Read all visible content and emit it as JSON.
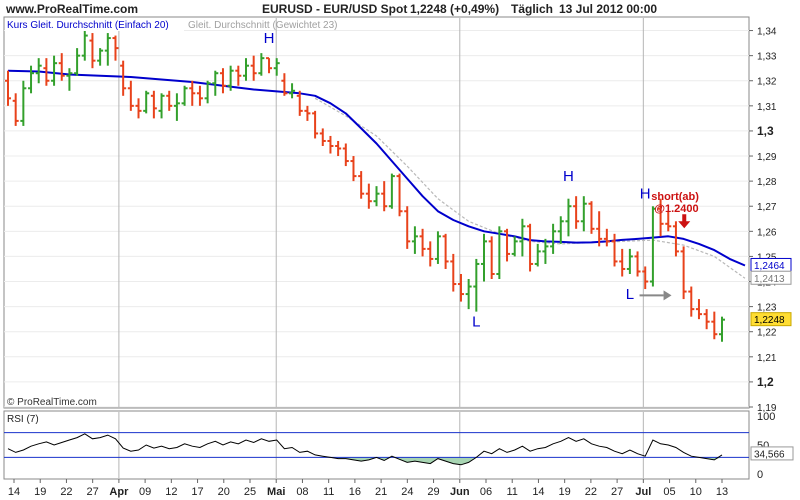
{
  "header": {
    "site": "www.ProRealTime.com",
    "title": "EURUSD - EUR/USD Spot",
    "quote": "1,2248 (+0,49%)",
    "period": "Täglich",
    "date": "13 Jul 2012 00:00"
  },
  "footer": {
    "copyright": "© ProRealTime.com"
  },
  "colors": {
    "up": "#33a02c",
    "down": "#e8421b",
    "sma": "#0000cc",
    "wma": "#b8b8b8",
    "rsi_line": "#000000",
    "rsi_fill": "#a8d5b3",
    "rsi_level": "#1a33cc",
    "annotation_blue": "#0000cc",
    "annotation_red": "#cc1111",
    "price_badge": "#ffdd33"
  },
  "chart_data": [
    {
      "type": "ohlc",
      "legend": [
        {
          "label": "Kurs Gleit. Durchschnitt (Einfach 20)",
          "color": "#0000cc"
        },
        {
          "label": "Gleit. Durchschnitt (Gewichtet 23)",
          "color": "#b8b8b8"
        }
      ],
      "ylim": [
        1.19,
        1.345
      ],
      "y_ticks": [
        "1,34",
        "1,33",
        "1,32",
        "1,31",
        "1,3",
        "1,29",
        "1,28",
        "1,27",
        "1,26",
        "1,25",
        "1,24",
        "1,23",
        "1,22",
        "1,21",
        "1,2",
        "1,19"
      ],
      "x_labels": [
        "14",
        "19",
        "22",
        "27",
        "Apr",
        "09",
        "12",
        "17",
        "20",
        "25",
        "Mai",
        "08",
        "11",
        "16",
        "21",
        "24",
        "29",
        "Jun",
        "06",
        "11",
        "14",
        "19",
        "22",
        "27",
        "Jul",
        "05",
        "10",
        "13"
      ],
      "bars": [
        {
          "o": 1.32,
          "h": 1.324,
          "l": 1.31,
          "c": 1.313
        },
        {
          "o": 1.312,
          "h": 1.315,
          "l": 1.302,
          "c": 1.304
        },
        {
          "o": 1.304,
          "h": 1.32,
          "l": 1.302,
          "c": 1.317
        },
        {
          "o": 1.317,
          "h": 1.326,
          "l": 1.315,
          "c": 1.323
        },
        {
          "o": 1.323,
          "h": 1.329,
          "l": 1.319,
          "c": 1.326
        },
        {
          "o": 1.325,
          "h": 1.329,
          "l": 1.318,
          "c": 1.32
        },
        {
          "o": 1.32,
          "h": 1.33,
          "l": 1.318,
          "c": 1.327
        },
        {
          "o": 1.327,
          "h": 1.331,
          "l": 1.32,
          "c": 1.322
        },
        {
          "o": 1.322,
          "h": 1.325,
          "l": 1.316,
          "c": 1.323
        },
        {
          "o": 1.323,
          "h": 1.333,
          "l": 1.322,
          "c": 1.33
        },
        {
          "o": 1.33,
          "h": 1.34,
          "l": 1.328,
          "c": 1.338
        },
        {
          "o": 1.336,
          "h": 1.339,
          "l": 1.325,
          "c": 1.328
        },
        {
          "o": 1.328,
          "h": 1.333,
          "l": 1.326,
          "c": 1.332
        },
        {
          "o": 1.332,
          "h": 1.339,
          "l": 1.326,
          "c": 1.337
        },
        {
          "o": 1.337,
          "h": 1.338,
          "l": 1.328,
          "c": 1.333
        },
        {
          "o": 1.326,
          "h": 1.328,
          "l": 1.314,
          "c": 1.317
        },
        {
          "o": 1.317,
          "h": 1.32,
          "l": 1.308,
          "c": 1.31
        },
        {
          "o": 1.31,
          "h": 1.313,
          "l": 1.305,
          "c": 1.308
        },
        {
          "o": 1.308,
          "h": 1.316,
          "l": 1.307,
          "c": 1.315
        },
        {
          "o": 1.314,
          "h": 1.316,
          "l": 1.305,
          "c": 1.309
        },
        {
          "o": 1.308,
          "h": 1.315,
          "l": 1.305,
          "c": 1.314
        },
        {
          "o": 1.314,
          "h": 1.316,
          "l": 1.308,
          "c": 1.31
        },
        {
          "o": 1.31,
          "h": 1.315,
          "l": 1.304,
          "c": 1.311
        },
        {
          "o": 1.311,
          "h": 1.318,
          "l": 1.31,
          "c": 1.317
        },
        {
          "o": 1.317,
          "h": 1.32,
          "l": 1.31,
          "c": 1.315
        },
        {
          "o": 1.315,
          "h": 1.318,
          "l": 1.31,
          "c": 1.313
        },
        {
          "o": 1.313,
          "h": 1.32,
          "l": 1.311,
          "c": 1.319
        },
        {
          "o": 1.319,
          "h": 1.324,
          "l": 1.314,
          "c": 1.323
        },
        {
          "o": 1.323,
          "h": 1.325,
          "l": 1.315,
          "c": 1.318
        },
        {
          "o": 1.318,
          "h": 1.326,
          "l": 1.316,
          "c": 1.324
        },
        {
          "o": 1.324,
          "h": 1.326,
          "l": 1.318,
          "c": 1.322
        },
        {
          "o": 1.322,
          "h": 1.329,
          "l": 1.32,
          "c": 1.326
        },
        {
          "o": 1.326,
          "h": 1.33,
          "l": 1.32,
          "c": 1.323
        },
        {
          "o": 1.323,
          "h": 1.331,
          "l": 1.322,
          "c": 1.329
        },
        {
          "o": 1.329,
          "h": 1.329,
          "l": 1.323,
          "c": 1.325
        },
        {
          "o": 1.325,
          "h": 1.329,
          "l": 1.322,
          "c": 1.327
        },
        {
          "o": 1.32,
          "h": 1.323,
          "l": 1.314,
          "c": 1.315
        },
        {
          "o": 1.315,
          "h": 1.319,
          "l": 1.313,
          "c": 1.316
        },
        {
          "o": 1.314,
          "h": 1.316,
          "l": 1.306,
          "c": 1.308
        },
        {
          "o": 1.308,
          "h": 1.31,
          "l": 1.304,
          "c": 1.307
        },
        {
          "o": 1.307,
          "h": 1.308,
          "l": 1.297,
          "c": 1.299
        },
        {
          "o": 1.299,
          "h": 1.301,
          "l": 1.294,
          "c": 1.296
        },
        {
          "o": 1.296,
          "h": 1.298,
          "l": 1.291,
          "c": 1.294
        },
        {
          "o": 1.294,
          "h": 1.296,
          "l": 1.29,
          "c": 1.293
        },
        {
          "o": 1.293,
          "h": 1.295,
          "l": 1.286,
          "c": 1.288
        },
        {
          "o": 1.288,
          "h": 1.29,
          "l": 1.28,
          "c": 1.282
        },
        {
          "o": 1.282,
          "h": 1.284,
          "l": 1.273,
          "c": 1.275
        },
        {
          "o": 1.275,
          "h": 1.279,
          "l": 1.269,
          "c": 1.272
        },
        {
          "o": 1.272,
          "h": 1.278,
          "l": 1.27,
          "c": 1.275
        },
        {
          "o": 1.275,
          "h": 1.28,
          "l": 1.268,
          "c": 1.27
        },
        {
          "o": 1.27,
          "h": 1.283,
          "l": 1.269,
          "c": 1.282
        },
        {
          "o": 1.282,
          "h": 1.283,
          "l": 1.266,
          "c": 1.268
        },
        {
          "o": 1.268,
          "h": 1.27,
          "l": 1.253,
          "c": 1.256
        },
        {
          "o": 1.256,
          "h": 1.262,
          "l": 1.251,
          "c": 1.258
        },
        {
          "o": 1.258,
          "h": 1.261,
          "l": 1.25,
          "c": 1.253
        },
        {
          "o": 1.253,
          "h": 1.256,
          "l": 1.246,
          "c": 1.249
        },
        {
          "o": 1.249,
          "h": 1.26,
          "l": 1.247,
          "c": 1.258
        },
        {
          "o": 1.258,
          "h": 1.259,
          "l": 1.245,
          "c": 1.248
        },
        {
          "o": 1.248,
          "h": 1.251,
          "l": 1.236,
          "c": 1.239
        },
        {
          "o": 1.239,
          "h": 1.243,
          "l": 1.232,
          "c": 1.235
        },
        {
          "o": 1.235,
          "h": 1.241,
          "l": 1.229,
          "c": 1.238
        },
        {
          "o": 1.238,
          "h": 1.249,
          "l": 1.228,
          "c": 1.247
        },
        {
          "o": 1.247,
          "h": 1.259,
          "l": 1.24,
          "c": 1.256
        },
        {
          "o": 1.256,
          "h": 1.258,
          "l": 1.241,
          "c": 1.243
        },
        {
          "o": 1.243,
          "h": 1.262,
          "l": 1.241,
          "c": 1.26
        },
        {
          "o": 1.26,
          "h": 1.261,
          "l": 1.248,
          "c": 1.251
        },
        {
          "o": 1.251,
          "h": 1.258,
          "l": 1.25,
          "c": 1.256
        },
        {
          "o": 1.256,
          "h": 1.265,
          "l": 1.25,
          "c": 1.262
        },
        {
          "o": 1.262,
          "h": 1.263,
          "l": 1.244,
          "c": 1.247
        },
        {
          "o": 1.247,
          "h": 1.255,
          "l": 1.246,
          "c": 1.252
        },
        {
          "o": 1.252,
          "h": 1.257,
          "l": 1.247,
          "c": 1.254
        },
        {
          "o": 1.254,
          "h": 1.263,
          "l": 1.251,
          "c": 1.26
        },
        {
          "o": 1.26,
          "h": 1.266,
          "l": 1.255,
          "c": 1.264
        },
        {
          "o": 1.264,
          "h": 1.273,
          "l": 1.258,
          "c": 1.27
        },
        {
          "o": 1.27,
          "h": 1.274,
          "l": 1.261,
          "c": 1.264
        },
        {
          "o": 1.264,
          "h": 1.274,
          "l": 1.26,
          "c": 1.271
        },
        {
          "o": 1.271,
          "h": 1.272,
          "l": 1.259,
          "c": 1.261
        },
        {
          "o": 1.261,
          "h": 1.268,
          "l": 1.254,
          "c": 1.257
        },
        {
          "o": 1.257,
          "h": 1.261,
          "l": 1.254,
          "c": 1.256
        },
        {
          "o": 1.256,
          "h": 1.259,
          "l": 1.246,
          "c": 1.248
        },
        {
          "o": 1.248,
          "h": 1.253,
          "l": 1.242,
          "c": 1.245
        },
        {
          "o": 1.245,
          "h": 1.253,
          "l": 1.243,
          "c": 1.25
        },
        {
          "o": 1.25,
          "h": 1.252,
          "l": 1.242,
          "c": 1.244
        },
        {
          "o": 1.244,
          "h": 1.246,
          "l": 1.237,
          "c": 1.24
        },
        {
          "o": 1.24,
          "h": 1.27,
          "l": 1.238,
          "c": 1.269
        },
        {
          "o": 1.269,
          "h": 1.273,
          "l": 1.258,
          "c": 1.263
        },
        {
          "o": 1.263,
          "h": 1.268,
          "l": 1.26,
          "c": 1.262
        },
        {
          "o": 1.262,
          "h": 1.264,
          "l": 1.25,
          "c": 1.252
        },
        {
          "o": 1.252,
          "h": 1.254,
          "l": 1.233,
          "c": 1.236
        },
        {
          "o": 1.236,
          "h": 1.238,
          "l": 1.226,
          "c": 1.229
        },
        {
          "o": 1.229,
          "h": 1.233,
          "l": 1.225,
          "c": 1.227
        },
        {
          "o": 1.227,
          "h": 1.229,
          "l": 1.221,
          "c": 1.224
        },
        {
          "o": 1.224,
          "h": 1.228,
          "l": 1.217,
          "c": 1.219
        },
        {
          "o": 1.219,
          "h": 1.226,
          "l": 1.216,
          "c": 1.2248
        }
      ],
      "sma_20": [
        [
          0,
          1.324
        ],
        [
          4,
          1.3237
        ],
        [
          8,
          1.3225
        ],
        [
          12,
          1.322
        ],
        [
          16,
          1.3215
        ],
        [
          20,
          1.3205
        ],
        [
          24,
          1.3195
        ],
        [
          28,
          1.318
        ],
        [
          32,
          1.3165
        ],
        [
          36,
          1.3155
        ],
        [
          38,
          1.315
        ],
        [
          40,
          1.314
        ],
        [
          42,
          1.311
        ],
        [
          44,
          1.307
        ],
        [
          46,
          1.301
        ],
        [
          48,
          1.295
        ],
        [
          50,
          1.288
        ],
        [
          52,
          1.281
        ],
        [
          54,
          1.274
        ],
        [
          56,
          1.268
        ],
        [
          58,
          1.2645
        ],
        [
          60,
          1.262
        ],
        [
          62,
          1.26
        ],
        [
          64,
          1.259
        ],
        [
          66,
          1.258
        ],
        [
          68,
          1.2565
        ],
        [
          70,
          1.256
        ],
        [
          72,
          1.2558
        ],
        [
          74,
          1.2555
        ],
        [
          76,
          1.2556
        ],
        [
          78,
          1.256
        ],
        [
          80,
          1.2566
        ],
        [
          82,
          1.257
        ],
        [
          84,
          1.2575
        ],
        [
          86,
          1.258
        ],
        [
          88,
          1.257
        ],
        [
          90,
          1.255
        ],
        [
          92,
          1.2525
        ],
        [
          94,
          1.249
        ],
        [
          96,
          1.2464
        ]
      ],
      "wma_23": [
        [
          40,
          1.313
        ],
        [
          44,
          1.306
        ],
        [
          48,
          1.298
        ],
        [
          52,
          1.286
        ],
        [
          56,
          1.273
        ],
        [
          60,
          1.264
        ],
        [
          64,
          1.259
        ],
        [
          68,
          1.256
        ],
        [
          72,
          1.255
        ],
        [
          76,
          1.2555
        ],
        [
          80,
          1.256
        ],
        [
          84,
          1.2565
        ],
        [
          88,
          1.2545
        ],
        [
          92,
          1.25
        ],
        [
          96,
          1.2413
        ]
      ],
      "annotations": [
        {
          "label": "H",
          "bar": 34,
          "price": 1.335,
          "color": "#0000cc"
        },
        {
          "label": "L",
          "bar": 61,
          "price": 1.222,
          "color": "#0000cc"
        },
        {
          "label": "H",
          "bar": 73,
          "price": 1.28,
          "color": "#0000cc"
        },
        {
          "label": "H",
          "bar": 83,
          "price": 1.273,
          "color": "#0000cc"
        },
        {
          "label": "L",
          "bar": 81,
          "price": 1.233,
          "color": "#0000cc"
        }
      ],
      "short_note": {
        "line1": "short(ab)",
        "line2": "@1.2400",
        "bar": 86,
        "price": 1.27
      },
      "right_labels": [
        {
          "text": "1,2464",
          "price": 1.2464,
          "style": "blue"
        },
        {
          "text": "1,2413",
          "price": 1.2413,
          "style": "gray"
        },
        {
          "text": "1,2248",
          "price": 1.2248,
          "style": "yellow"
        }
      ]
    },
    {
      "type": "line",
      "title": "RSI (7)",
      "ylim": [
        0,
        100
      ],
      "levels": [
        70,
        30
      ],
      "y_ticks": [
        "100",
        "50",
        "0"
      ],
      "last_value": "34,566",
      "values": [
        44,
        38,
        42,
        48,
        52,
        55,
        50,
        54,
        58,
        62,
        68,
        60,
        62,
        66,
        60,
        45,
        40,
        42,
        50,
        45,
        48,
        44,
        46,
        52,
        48,
        46,
        52,
        56,
        50,
        55,
        52,
        58,
        54,
        60,
        56,
        58,
        44,
        46,
        38,
        40,
        34,
        32,
        30,
        28,
        28,
        26,
        24,
        26,
        30,
        25,
        32,
        27,
        22,
        24,
        22,
        20,
        28,
        24,
        20,
        18,
        22,
        30,
        40,
        36,
        44,
        38,
        42,
        48,
        40,
        44,
        46,
        52,
        56,
        62,
        56,
        60,
        52,
        48,
        46,
        40,
        36,
        42,
        36,
        32,
        58,
        52,
        50,
        46,
        38,
        32,
        30,
        28,
        26,
        34
      ]
    }
  ]
}
